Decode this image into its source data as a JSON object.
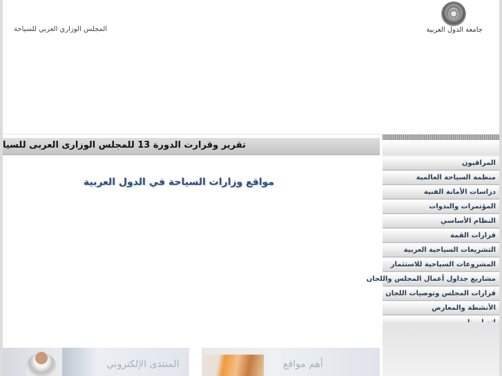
{
  "header": {
    "org_name": "جامعة الدول العربية",
    "council_name": "المجلس الوزاري العربي للسياحة"
  },
  "content": {
    "title": "تقرير وقرارت الدورة 13 للمجلس الوزارى العربى للسيا",
    "ministries_link": "مواقع وزارات السياحة في الدول العربية"
  },
  "banners": {
    "left_text": "المنتدى الإلكتروني",
    "right_text": "أهم مواقع"
  },
  "sidebar": {
    "items": [
      {
        "label": "المراقبون"
      },
      {
        "label": "منظمة السياحة العالمية"
      },
      {
        "label": "دراسات الأمانة الفنية"
      },
      {
        "label": "المؤتمرات والندوات"
      },
      {
        "label": "النظام الأساسي"
      },
      {
        "label": "قرارات القمة"
      },
      {
        "label": "التشريعات السياحية العربية"
      },
      {
        "label": "المشروعات السياحية للاستثمار"
      },
      {
        "label": "مشاريع جداول أعمال المجلس واللجان"
      },
      {
        "label": "قرارات المجلس وتوصيات اللجان"
      },
      {
        "label": "الأنشطة والمعارض"
      },
      {
        "label": "إتصل بنا"
      }
    ]
  },
  "colors": {
    "menu_text": "#2d3e55",
    "link_text": "#2f4f7a",
    "page_bg": "#dcdcdc"
  }
}
